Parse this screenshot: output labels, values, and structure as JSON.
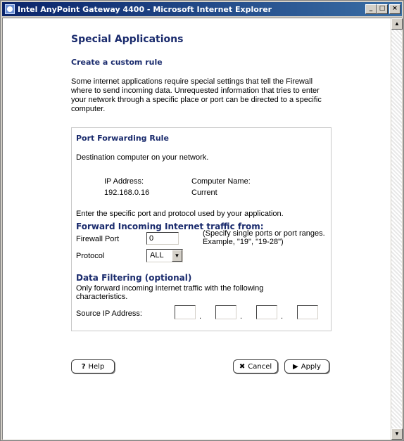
{
  "window": {
    "title": "Intel AnyPoint Gateway 4400 - Microsoft Internet Explorer",
    "controls": {
      "minimize": "_",
      "maximize": "□",
      "close": "×"
    },
    "icon": "ie-icon"
  },
  "page": {
    "title": "Special Applications",
    "subtitle": "Create a custom rule",
    "intro": "Some internet applications require special settings that tell the Firewall where to send incoming data. Unrequested information that tries to enter your network through a specific place or port can be directed to a specific computer."
  },
  "rule": {
    "title": "Port Forwarding Rule",
    "destination_desc": "Destination computer on your network.",
    "ip_label": "IP Address:",
    "ip_value": "192.168.0.16",
    "computer_name_label": "Computer Name:",
    "computer_name_value": "Current",
    "enter_text": "Enter the specific port and protocol used by your application."
  },
  "forward": {
    "heading": "Forward Incoming Internet traffic from:",
    "port_label": "Firewall Port",
    "port_value": "0",
    "hint": "(Specify single ports or port ranges. Example, \"19\", \"19-28\")",
    "protocol_label": "Protocol",
    "protocol_value": "ALL"
  },
  "filtering": {
    "heading": "Data Filtering (optional)",
    "desc": "Only forward incoming Internet traffic with the following characteristics.",
    "source_label": "Source IP Address:",
    "octets": [
      "",
      "",
      "",
      ""
    ],
    "separator": "."
  },
  "buttons": {
    "help": "Help",
    "help_icon": "?",
    "cancel": "Cancel",
    "cancel_icon": "✖",
    "apply": "Apply",
    "apply_icon": "▶"
  },
  "colors": {
    "heading": "#1a2b6d",
    "titlebar_start": "#0a246a",
    "titlebar_end": "#3a6ea5"
  }
}
